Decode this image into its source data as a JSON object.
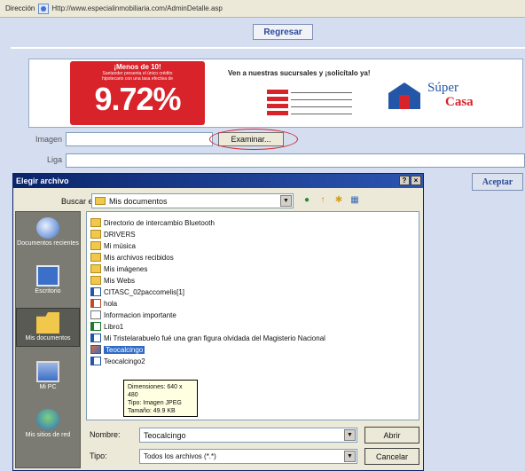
{
  "address_bar": {
    "label": "Dirección",
    "url": "Http://www.especialinmobiliaria.com/AdminDetalle.asp"
  },
  "page": {
    "back_button": "Regresar",
    "accept_button": "Aceptar"
  },
  "banner": {
    "promo_heading": "¡Menos de 10!",
    "promo_sub1": "Santander presenta el único crédito",
    "promo_sub2": "hipotecario con una tasa efectiva de",
    "promo_rate": "9.72%",
    "visit_text": "Ven a nuestras sucursales y ¡solicítalo ya!",
    "logo_line1": "Súper",
    "logo_line2": "Casa",
    "accent_color": "#d8232a",
    "brand_color": "#2456a8"
  },
  "form": {
    "imagen_label": "Imagen",
    "liga_label": "Liga",
    "examinar_button": "Examinar..."
  },
  "dialog": {
    "title": "Elegir archivo",
    "help_button": "?",
    "close_button": "×",
    "lookin_label": "Buscar en:",
    "lookin_value": "Mis documentos",
    "toolbar_icons": [
      "back-icon",
      "up-folder-icon",
      "new-folder-icon",
      "views-icon"
    ],
    "places": [
      {
        "label": "Documentos recientes",
        "icon": "recent-documents-icon"
      },
      {
        "label": "Escritorio",
        "icon": "desktop-icon"
      },
      {
        "label": "Mis documentos",
        "icon": "my-documents-icon"
      },
      {
        "label": "Mi PC",
        "icon": "my-computer-icon"
      },
      {
        "label": "Mis sitios de red",
        "icon": "network-places-icon"
      }
    ],
    "files": [
      {
        "name": "Directorio de intercambio Bluetooth",
        "type": "folder"
      },
      {
        "name": "DRIVERS",
        "type": "folder"
      },
      {
        "name": "Mi música",
        "type": "folder"
      },
      {
        "name": "Mis archivos recibidos",
        "type": "folder"
      },
      {
        "name": "Mis imágenes",
        "type": "folder"
      },
      {
        "name": "Mis Webs",
        "type": "folder"
      },
      {
        "name": "CITASC_02paccomelis[1]",
        "type": "word"
      },
      {
        "name": "hola",
        "type": "ppt"
      },
      {
        "name": "Informacion importante",
        "type": "text"
      },
      {
        "name": "Libro1",
        "type": "excel"
      },
      {
        "name": "Mi Tristelarabuelo fué una gran figura olvidada del Magisterio Nacional",
        "type": "word"
      },
      {
        "name": "Teocalcingo",
        "type": "image",
        "selected": true
      },
      {
        "name": "Teocalcingo2",
        "type": "word"
      }
    ],
    "tooltip": {
      "line1": "Dimensiones: 640 x 480",
      "line2": "Tipo: Imagen JPEG",
      "line3": "Tamaño: 49.9 KB"
    },
    "name_label": "Nombre:",
    "name_value": "Teocalcingo",
    "type_label": "Tipo:",
    "type_value": "Todos los archivos (*.*)",
    "open_button": "Abrir",
    "cancel_button": "Cancelar"
  }
}
